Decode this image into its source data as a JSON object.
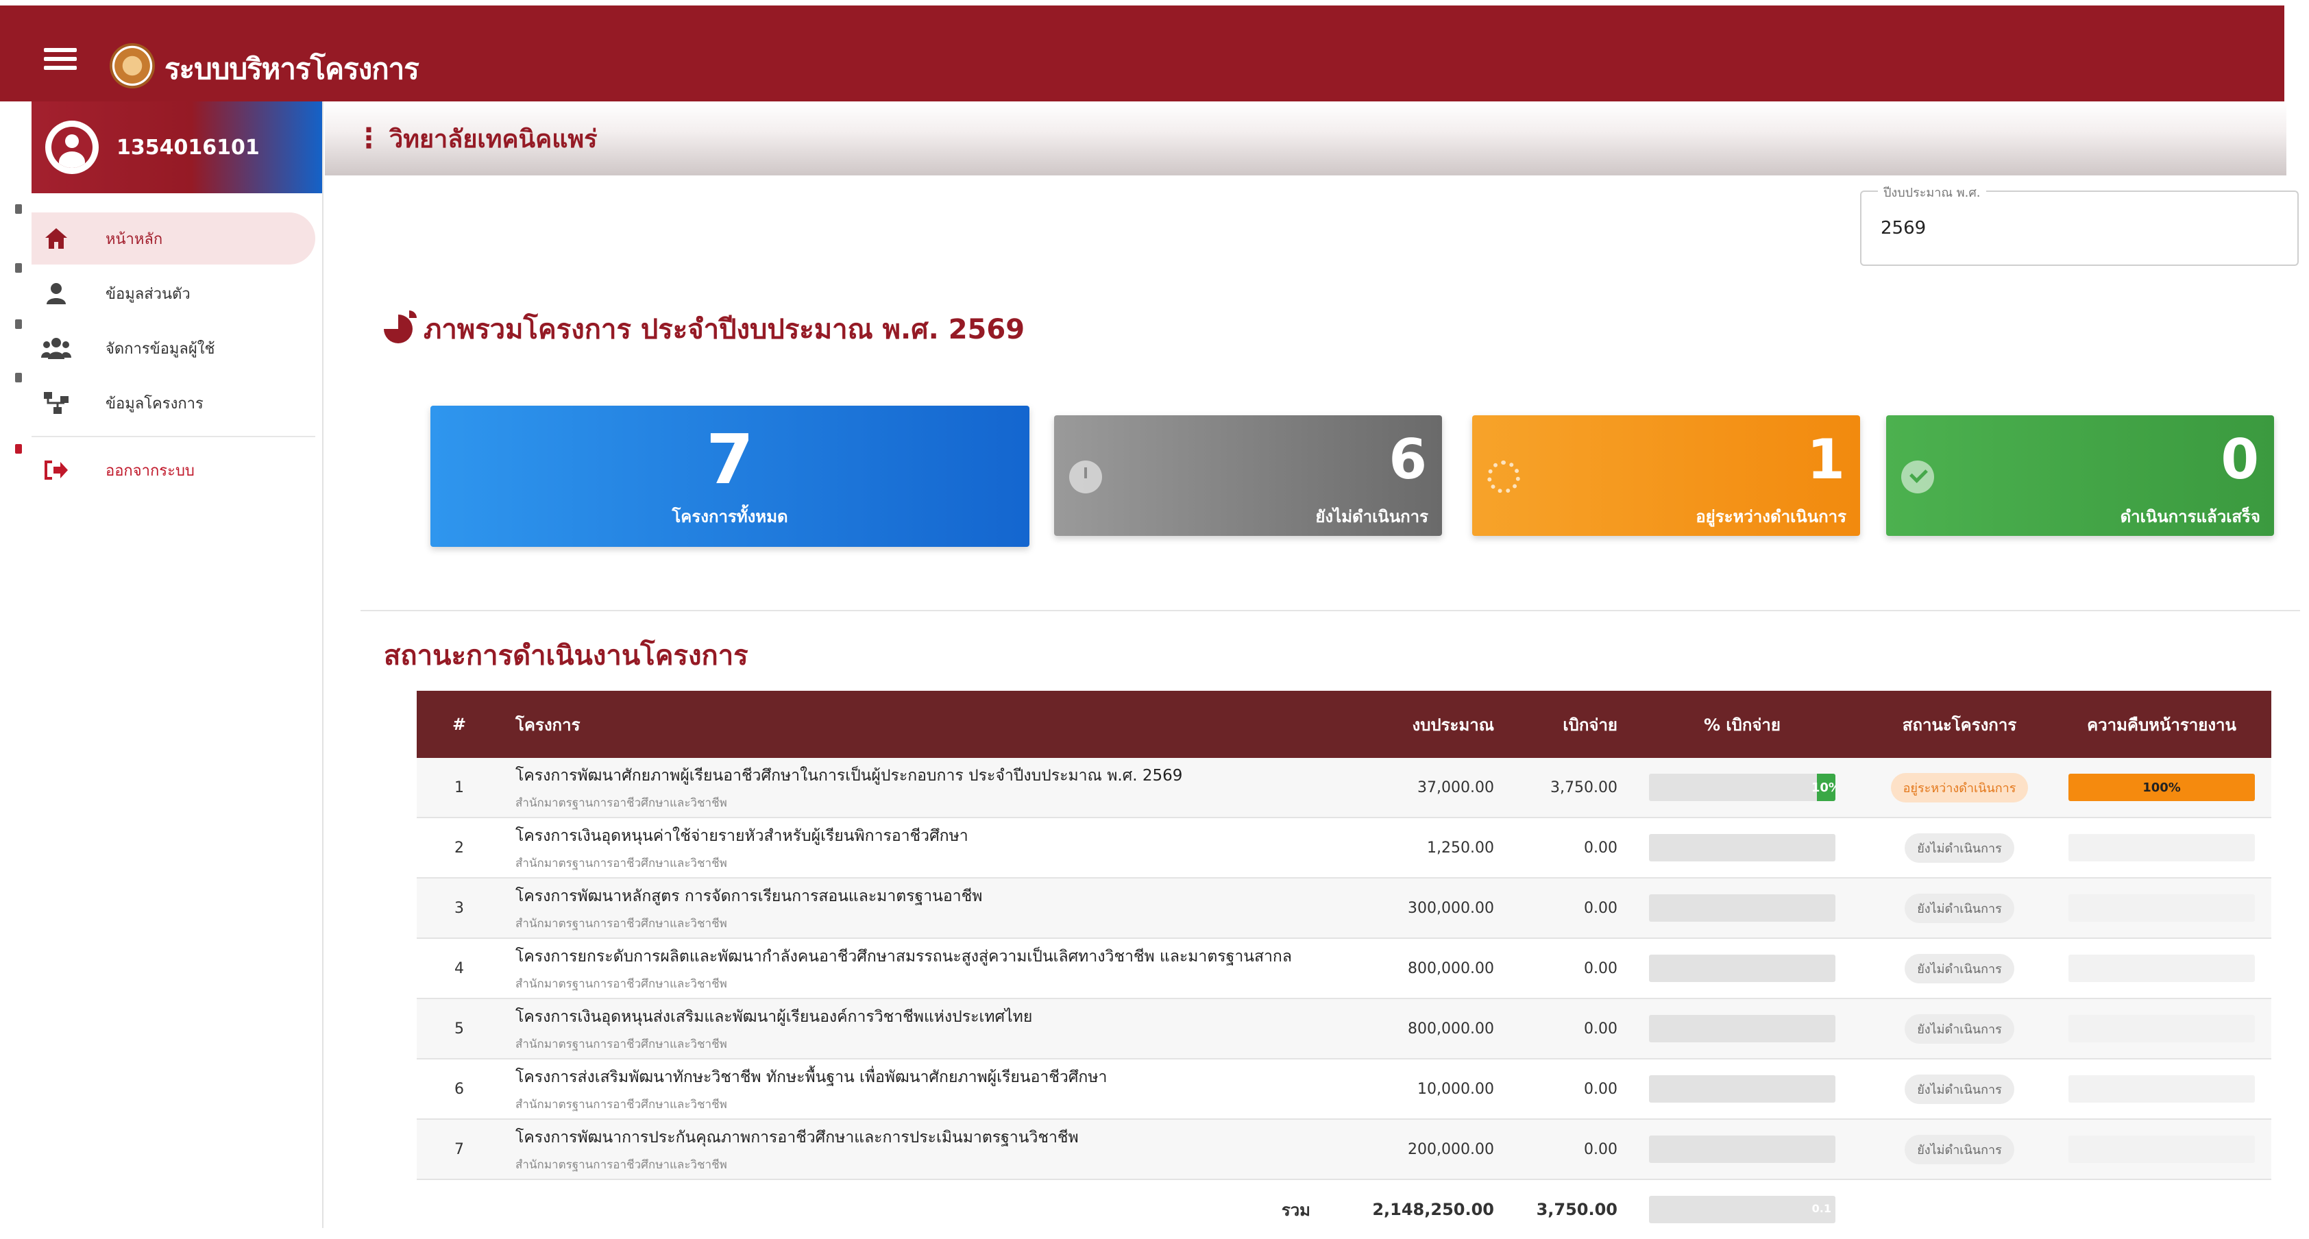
{
  "app": {
    "title": "ระบบบริหารโครงการ"
  },
  "user": {
    "id": "1354016101"
  },
  "sidebar": {
    "items": [
      {
        "label": "หน้าหลัก",
        "icon": "home-icon"
      },
      {
        "label": "ข้อมูลส่วนตัว",
        "icon": "user-icon"
      },
      {
        "label": "จัดการข้อมูลผู้ใช้",
        "icon": "users-icon"
      },
      {
        "label": "ข้อมูลโครงการ",
        "icon": "sitemap-icon"
      },
      {
        "label": "ออกจากระบบ",
        "icon": "logout-icon"
      }
    ]
  },
  "header": {
    "breadcrumb": "วิทยาลัยเทคนิคแพร่"
  },
  "year_filter": {
    "legend": "ปีงบประมาณ พ.ศ.",
    "value": "2569"
  },
  "overview": {
    "title": "ภาพรวมโครงการ ประจำปีงบประมาณ พ.ศ. 2569",
    "cards": {
      "total": {
        "value": "7",
        "label": "โครงการทั้งหมด"
      },
      "pending": {
        "value": "6",
        "label": "ยังไม่ดำเนินการ"
      },
      "in_progress": {
        "value": "1",
        "label": "อยู่ระหว่างดำเนินการ"
      },
      "done": {
        "value": "0",
        "label": "ดำเนินการแล้วเสร็จ"
      }
    }
  },
  "status_section": {
    "title": "สถานะการดำเนินงานโครงการ",
    "columns": [
      "#",
      "โครงการ",
      "งบประมาณ",
      "เบิกจ่าย",
      "% เบิกจ่าย",
      "สถานะโครงการ",
      "ความคืบหน้ารายงาน"
    ],
    "rows": [
      {
        "no": "1",
        "name": "โครงการพัฒนาศักยภาพผู้เรียนอาชีวศึกษาในการเป็นผู้ประกอบการ ประจำปีงบประมาณ พ.ศ. 2569",
        "dept": "สำนักมาตรฐานการอาชีวศึกษาและวิชาชีพ",
        "budget": "37,000.00",
        "paid": "3,750.00",
        "pct": 10,
        "pct_label": "10%",
        "status": "อยู่ระหว่างดำเนินการ",
        "status_type": "inprog",
        "progress": 100,
        "progress_label": "100%"
      },
      {
        "no": "2",
        "name": "โครงการเงินอุดหนุนค่าใช้จ่ายรายหัวสำหรับผู้เรียนพิการอาชีวศึกษา",
        "dept": "สำนักมาตรฐานการอาชีวศึกษาและวิชาชีพ",
        "budget": "1,250.00",
        "paid": "0.00",
        "pct": 0,
        "pct_label": "",
        "status": "ยังไม่ดำเนินการ",
        "status_type": "notyet",
        "progress": 0,
        "progress_label": ""
      },
      {
        "no": "3",
        "name": "โครงการพัฒนาหลักสูตร การจัดการเรียนการสอนและมาตรฐานอาชีพ",
        "dept": "สำนักมาตรฐานการอาชีวศึกษาและวิชาชีพ",
        "budget": "300,000.00",
        "paid": "0.00",
        "pct": 0,
        "pct_label": "",
        "status": "ยังไม่ดำเนินการ",
        "status_type": "notyet",
        "progress": 0,
        "progress_label": ""
      },
      {
        "no": "4",
        "name": "โครงการยกระดับการผลิตและพัฒนากำลังคนอาชีวศึกษาสมรรถนะสูงสู่ความเป็นเลิศทางวิชาชีพ และมาตรฐานสากล",
        "dept": "สำนักมาตรฐานการอาชีวศึกษาและวิชาชีพ",
        "budget": "800,000.00",
        "paid": "0.00",
        "pct": 0,
        "pct_label": "",
        "status": "ยังไม่ดำเนินการ",
        "status_type": "notyet",
        "progress": 0,
        "progress_label": ""
      },
      {
        "no": "5",
        "name": "โครงการเงินอุดหนุนส่งเสริมและพัฒนาผู้เรียนองค์การวิชาชีพแห่งประเทศไทย",
        "dept": "สำนักมาตรฐานการอาชีวศึกษาและวิชาชีพ",
        "budget": "800,000.00",
        "paid": "0.00",
        "pct": 0,
        "pct_label": "",
        "status": "ยังไม่ดำเนินการ",
        "status_type": "notyet",
        "progress": 0,
        "progress_label": ""
      },
      {
        "no": "6",
        "name": "โครงการส่งเสริมพัฒนาทักษะวิชาชีพ ทักษะพื้นฐาน เพื่อพัฒนาศักยภาพผู้เรียนอาชีวศึกษา",
        "dept": "สำนักมาตรฐานการอาชีวศึกษาและวิชาชีพ",
        "budget": "10,000.00",
        "paid": "0.00",
        "pct": 0,
        "pct_label": "",
        "status": "ยังไม่ดำเนินการ",
        "status_type": "notyet",
        "progress": 0,
        "progress_label": ""
      },
      {
        "no": "7",
        "name": "โครงการพัฒนาการประกันคุณภาพการอาชีวศึกษาและการประเมินมาตรฐานวิชาชีพ",
        "dept": "สำนักมาตรฐานการอาชีวศึกษาและวิชาชีพ",
        "budget": "200,000.00",
        "paid": "0.00",
        "pct": 0,
        "pct_label": "",
        "status": "ยังไม่ดำเนินการ",
        "status_type": "notyet",
        "progress": 0,
        "progress_label": ""
      }
    ],
    "totals": {
      "label": "รวม",
      "budget": "2,148,250.00",
      "paid": "3,750.00",
      "pct_label": "0.1"
    }
  },
  "colors": {
    "brand": "#951a25",
    "table_header": "#6b2427",
    "in_progress": "#f28a0e",
    "done": "#3b9a3f",
    "total": "#1466cf",
    "pending": "#6a6a6a"
  }
}
